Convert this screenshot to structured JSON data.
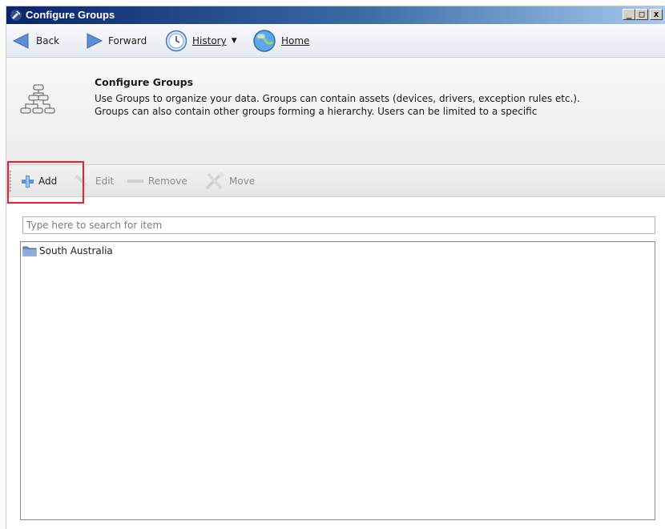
{
  "window": {
    "title": "Configure Groups",
    "controls": {
      "minimize": "_",
      "maximize": "□",
      "close": "x"
    }
  },
  "nav": {
    "back": {
      "label": "Back",
      "icon": "back-arrow-icon"
    },
    "forward": {
      "label": "Forward",
      "icon": "forward-arrow-icon"
    },
    "history": {
      "label": "History",
      "icon": "clock-icon"
    },
    "home": {
      "label": "Home",
      "icon": "globe-home-icon"
    }
  },
  "header": {
    "title": "Configure Groups",
    "description": "Use Groups to organize your data. Groups can contain assets (devices, drivers, exception rules etc.). Groups can also contain other groups forming a hierarchy. Users can be limited to a specific",
    "icon": "hierarchy-icon"
  },
  "toolbar": {
    "add": {
      "label": "Add",
      "icon": "plus-icon",
      "enabled": true
    },
    "edit": {
      "label": "Edit",
      "icon": "pencil-icon",
      "enabled": false
    },
    "remove": {
      "label": "Remove",
      "icon": "minus-icon",
      "enabled": false
    },
    "move": {
      "label": "Move",
      "icon": "tools-icon",
      "enabled": false
    }
  },
  "search": {
    "placeholder": "Type here to search for item",
    "value": ""
  },
  "tree": {
    "items": [
      {
        "label": "South Australia",
        "icon": "folder-icon"
      }
    ]
  },
  "colors": {
    "highlight": "#e8202a",
    "title_bar": "#0a246a"
  }
}
